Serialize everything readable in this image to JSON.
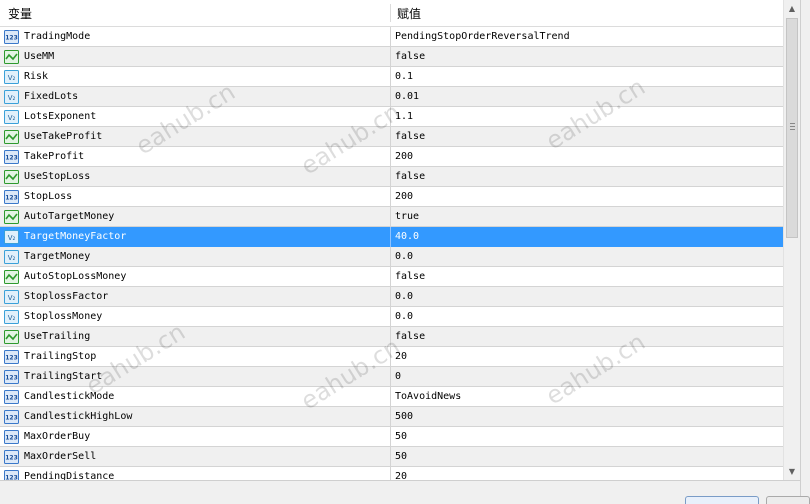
{
  "header": {
    "name_col": "变量",
    "value_col": "赋值"
  },
  "rows": [
    {
      "icon": "int",
      "name": "TradingMode",
      "value": "PendingStopOrderReversalTrend"
    },
    {
      "icon": "bool",
      "name": "UseMM",
      "value": "false"
    },
    {
      "icon": "double",
      "name": "Risk",
      "value": "0.1"
    },
    {
      "icon": "double",
      "name": "FixedLots",
      "value": "0.01"
    },
    {
      "icon": "double",
      "name": "LotsExponent",
      "value": "1.1"
    },
    {
      "icon": "bool",
      "name": "UseTakeProfit",
      "value": "false"
    },
    {
      "icon": "int",
      "name": "TakeProfit",
      "value": "200"
    },
    {
      "icon": "bool",
      "name": "UseStopLoss",
      "value": "false"
    },
    {
      "icon": "int",
      "name": "StopLoss",
      "value": "200"
    },
    {
      "icon": "bool",
      "name": "AutoTargetMoney",
      "value": "true"
    },
    {
      "icon": "double",
      "name": "TargetMoneyFactor",
      "value": "40.0",
      "selected": true
    },
    {
      "icon": "double",
      "name": "TargetMoney",
      "value": "0.0"
    },
    {
      "icon": "bool",
      "name": "AutoStopLossMoney",
      "value": "false"
    },
    {
      "icon": "double",
      "name": "StoplossFactor",
      "value": "0.0"
    },
    {
      "icon": "double",
      "name": "StoplossMoney",
      "value": "0.0"
    },
    {
      "icon": "bool",
      "name": "UseTrailing",
      "value": "false"
    },
    {
      "icon": "int",
      "name": "TrailingStop",
      "value": "20"
    },
    {
      "icon": "int",
      "name": "TrailingStart",
      "value": "0"
    },
    {
      "icon": "int",
      "name": "CandlestickMode",
      "value": "ToAvoidNews"
    },
    {
      "icon": "int",
      "name": "CandlestickHighLow",
      "value": "500"
    },
    {
      "icon": "int",
      "name": "MaxOrderBuy",
      "value": "50"
    },
    {
      "icon": "int",
      "name": "MaxOrderSell",
      "value": "50"
    },
    {
      "icon": "int",
      "name": "PendingDistance",
      "value": "20"
    }
  ],
  "watermark": "eahub.cn",
  "icon_labels": {
    "int": "123",
    "double": "V₂"
  },
  "colors": {
    "selection": "#3399ff",
    "alt_row": "#f0f0f0",
    "int_icon": "#3a78c9",
    "bool_icon": "#2e9a2e",
    "double_icon": "#3aa0d8"
  }
}
